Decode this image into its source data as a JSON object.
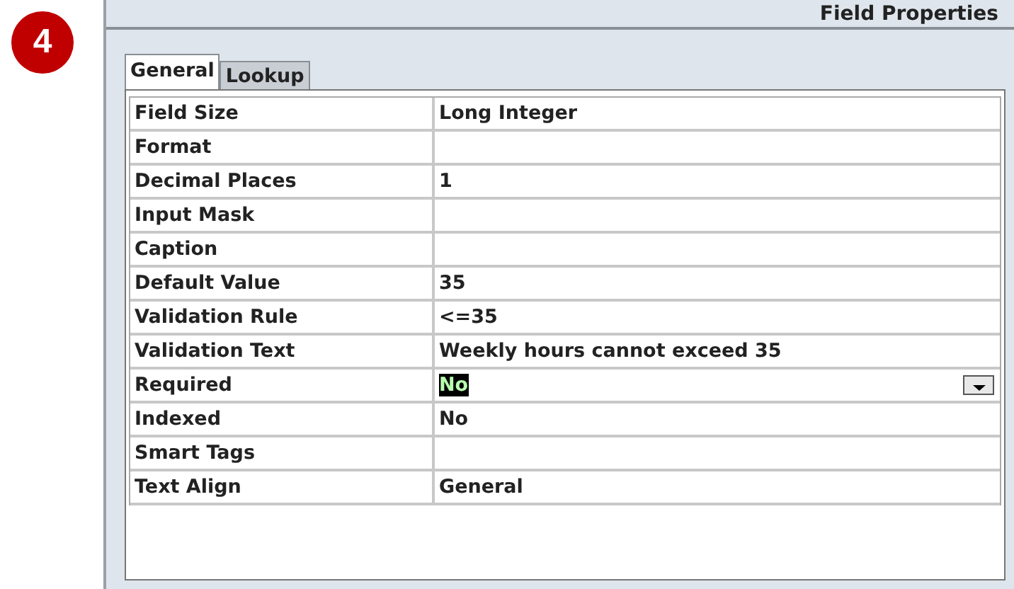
{
  "step_badge": "4",
  "panel": {
    "title": "Field Properties"
  },
  "tabs": [
    {
      "label": "General",
      "selected": true
    },
    {
      "label": "Lookup",
      "selected": false
    }
  ],
  "properties": [
    {
      "name": "Field Size",
      "value": "Long Integer",
      "selected": false
    },
    {
      "name": "Format",
      "selected": false
    },
    {
      "name": "Decimal Places",
      "value": "1",
      "selected": false
    },
    {
      "name": "Input Mask",
      "selected": false
    },
    {
      "name": "Caption",
      "selected": false
    },
    {
      "name": "Default Value",
      "value": "35",
      "selected": false
    },
    {
      "name": "Validation Rule",
      "value": "<=35",
      "selected": false
    },
    {
      "name": "Validation Text",
      "value": "Weekly hours cannot exceed 35",
      "selected": false
    },
    {
      "name": "Required",
      "value": "No",
      "selected": true
    },
    {
      "name": "Indexed",
      "value": "No",
      "selected": false
    },
    {
      "name": "Smart Tags",
      "selected": false
    },
    {
      "name": "Text Align",
      "value": "General",
      "selected": false
    }
  ]
}
